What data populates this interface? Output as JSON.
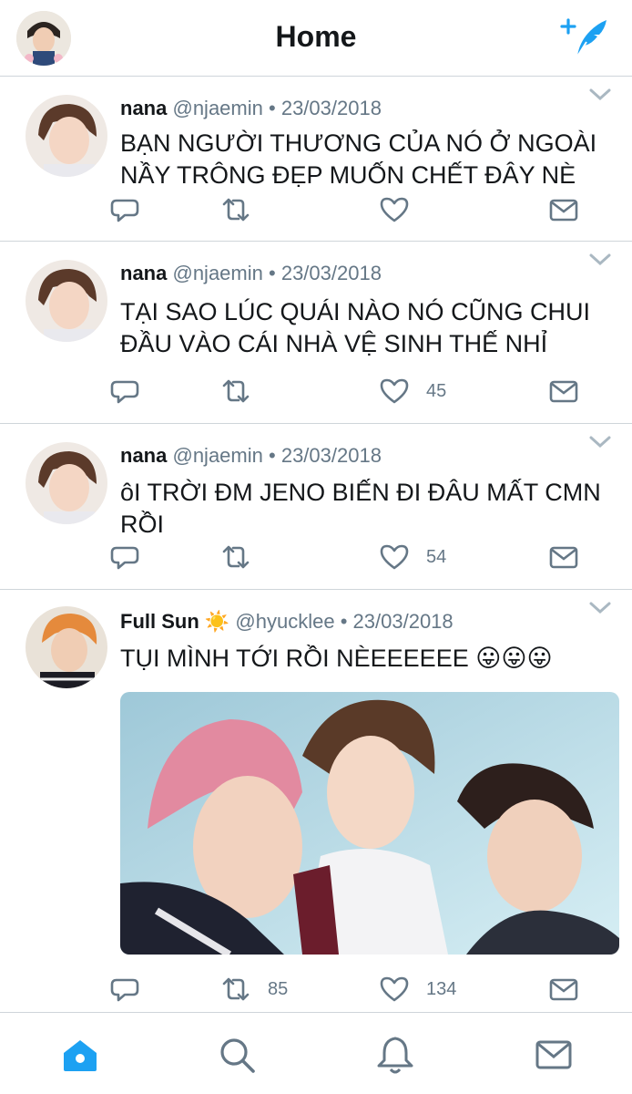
{
  "header": {
    "title": "Home"
  },
  "colors": {
    "accent": "#1da1f2",
    "secondary_text": "#657786",
    "divider": "#cfd5da"
  },
  "tweets": [
    {
      "name": "nana",
      "handle": "@njaemin",
      "separator": "•",
      "date": "23/03/2018",
      "text": "BẠN NGƯỜI THƯƠNG CỦA NÓ Ở NGOÀI NẦY TRÔNG ĐẸP MUỐN CHẾT ĐÂY NÈ",
      "likes": "",
      "retweets": ""
    },
    {
      "name": "nana",
      "handle": "@njaemin",
      "separator": "•",
      "date": "23/03/2018",
      "text": "TẠI SAO LÚC QUÁI NÀO NÓ CŨNG CHUI ĐẦU VÀO CÁI NHÀ VỆ SINH THẾ NHỈ",
      "likes": "45",
      "retweets": ""
    },
    {
      "name": "nana",
      "handle": "@njaemin",
      "separator": "•",
      "date": "23/03/2018",
      "text": "ôI TRỜI ĐM JENO BIẾN ĐI ĐÂU MẤT CMN RỒI",
      "likes": "54",
      "retweets": ""
    },
    {
      "name": "Full Sun",
      "emoji": "☀️",
      "handle": "@hyucklee",
      "separator": "•",
      "date": "23/03/2018",
      "text": "TỤI MÌNH TỚI RỒI NÈEEEEEE 😛😛😛",
      "likes": "134",
      "retweets": "85"
    }
  ],
  "icons": {
    "compose": "compose-tweet-icon",
    "reply": "reply-icon",
    "retweet": "retweet-icon",
    "like": "heart-icon",
    "dm": "envelope-icon",
    "more": "chevron-down-icon",
    "nav_home": "home-icon",
    "nav_search": "search-icon",
    "nav_notifications": "bell-icon",
    "nav_messages": "envelope-icon"
  }
}
